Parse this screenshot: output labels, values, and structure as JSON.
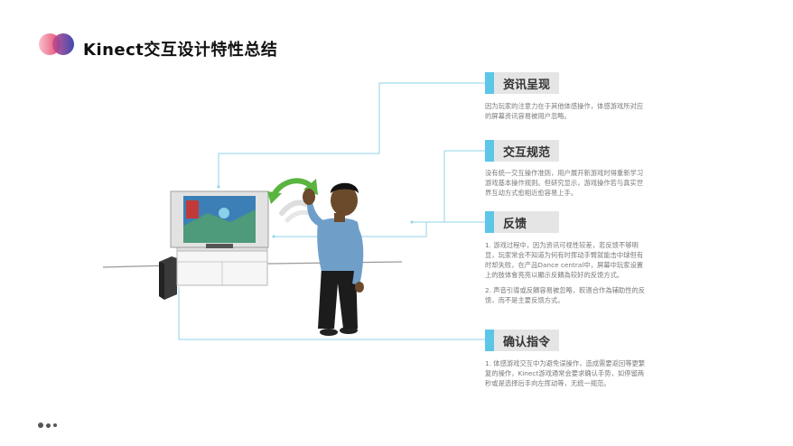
{
  "header": {
    "title": "Kinect交互设计特性总结"
  },
  "sections": [
    {
      "title": "资讯呈现",
      "paragraphs": [
        "因为玩家的注意力在于其他体感操作，体感游戏所对应的屏幕资讯容易被用户忽略。"
      ]
    },
    {
      "title": "交互规范",
      "paragraphs": [
        "没有统一交互操作准则，用户展开新游戏时得重新学习游戏基本操作规则。但研究显示，游戏操作若与真实世界互动方式愈相近愈容易上手。"
      ]
    },
    {
      "title": "反馈",
      "paragraphs": [
        "1. 游戏过程中，因为资讯可视性较差，若反馈不够明显，玩家常会不知道为何有时挥动手臂就能击中球但有时却失败，在产品Dance central中，屏幕中玩家设置上的肢体會亮亮以顯示反饋為较好的反馈方式。",
        "2. 声音引導或反饋容易被忽略，較適合作為辅助性的反馈，而不是主要反馈方式。"
      ]
    },
    {
      "title": "确认指令",
      "paragraphs": [
        "1. 体感游戏交互中为避免误操作，造成需要返回等更繁复的操作，Kinect游戏通常会要求确认手势，如停留两秒或是选择后手向左挥动等，无统一规范。"
      ]
    }
  ],
  "colors": {
    "accent": "#5bc6e6",
    "label_bg": "#e5e5e5",
    "logo_red": "#e8456b",
    "logo_blue": "#3a3fa8"
  },
  "icons": {
    "logo": "overlapping-circles-logo",
    "pager": "three-dots-icon",
    "illustration": "kinect-player-tv-illustration"
  }
}
